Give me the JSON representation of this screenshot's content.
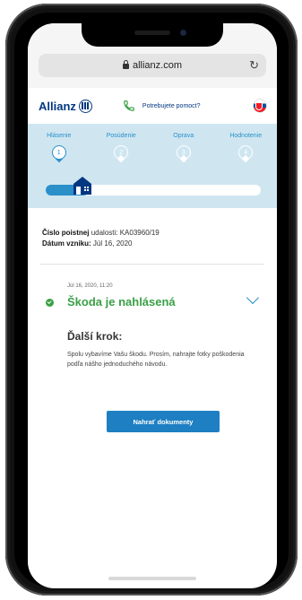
{
  "browser": {
    "url": "allianz.com",
    "reload_icon": "reload-icon",
    "lock_icon": "lock-icon"
  },
  "header": {
    "logo_text": "Allianz",
    "help_text": "Potrebujete pomoct?",
    "flag": "slovakia-flag-icon"
  },
  "progress": {
    "steps": [
      {
        "label": "Hlásenie",
        "number": "1"
      },
      {
        "label": "Posúdenie",
        "number": "2"
      },
      {
        "label": "Oprava",
        "number": "3"
      },
      {
        "label": "Hodnotenie",
        "number": "4"
      }
    ],
    "current_step": 1,
    "completion": 0.2
  },
  "claim": {
    "number_label_bold": "Číslo poistnej",
    "number_label_rest": "udalosti:",
    "number_value": "KA03960/19",
    "date_label": "Dátum vzniku:",
    "date_value": "Júl 16, 2020"
  },
  "event": {
    "timestamp": "Júl 16, 2020, 11:20",
    "status": "Škoda je nahlásená",
    "next_title": "Ďalší krok:",
    "next_text": "Spolu vybavíme Vašu škodu. Prosím, nahrajte fotky poškodenia podľa nášho jednoduchého návodu.",
    "button_label": "Nahrať dokumenty"
  },
  "colors": {
    "brand": "#003781",
    "accent": "#2b8fc9",
    "success": "#3aa046",
    "panel": "#cfe6f1"
  }
}
